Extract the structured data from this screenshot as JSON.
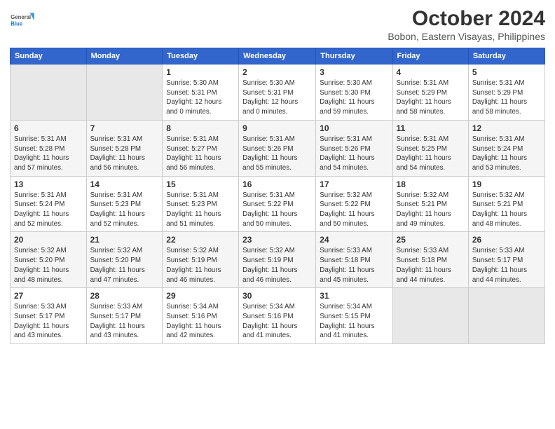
{
  "logo": {
    "line1": "General",
    "line2": "Blue"
  },
  "title": "October 2024",
  "subtitle": "Bobon, Eastern Visayas, Philippines",
  "weekdays": [
    "Sunday",
    "Monday",
    "Tuesday",
    "Wednesday",
    "Thursday",
    "Friday",
    "Saturday"
  ],
  "weeks": [
    [
      {
        "day": "",
        "info": ""
      },
      {
        "day": "",
        "info": ""
      },
      {
        "day": "1",
        "info": "Sunrise: 5:30 AM\nSunset: 5:31 PM\nDaylight: 12 hours\nand 0 minutes."
      },
      {
        "day": "2",
        "info": "Sunrise: 5:30 AM\nSunset: 5:31 PM\nDaylight: 12 hours\nand 0 minutes."
      },
      {
        "day": "3",
        "info": "Sunrise: 5:30 AM\nSunset: 5:30 PM\nDaylight: 11 hours\nand 59 minutes."
      },
      {
        "day": "4",
        "info": "Sunrise: 5:31 AM\nSunset: 5:29 PM\nDaylight: 11 hours\nand 58 minutes."
      },
      {
        "day": "5",
        "info": "Sunrise: 5:31 AM\nSunset: 5:29 PM\nDaylight: 11 hours\nand 58 minutes."
      }
    ],
    [
      {
        "day": "6",
        "info": "Sunrise: 5:31 AM\nSunset: 5:28 PM\nDaylight: 11 hours\nand 57 minutes."
      },
      {
        "day": "7",
        "info": "Sunrise: 5:31 AM\nSunset: 5:28 PM\nDaylight: 11 hours\nand 56 minutes."
      },
      {
        "day": "8",
        "info": "Sunrise: 5:31 AM\nSunset: 5:27 PM\nDaylight: 11 hours\nand 56 minutes."
      },
      {
        "day": "9",
        "info": "Sunrise: 5:31 AM\nSunset: 5:26 PM\nDaylight: 11 hours\nand 55 minutes."
      },
      {
        "day": "10",
        "info": "Sunrise: 5:31 AM\nSunset: 5:26 PM\nDaylight: 11 hours\nand 54 minutes."
      },
      {
        "day": "11",
        "info": "Sunrise: 5:31 AM\nSunset: 5:25 PM\nDaylight: 11 hours\nand 54 minutes."
      },
      {
        "day": "12",
        "info": "Sunrise: 5:31 AM\nSunset: 5:24 PM\nDaylight: 11 hours\nand 53 minutes."
      }
    ],
    [
      {
        "day": "13",
        "info": "Sunrise: 5:31 AM\nSunset: 5:24 PM\nDaylight: 11 hours\nand 52 minutes."
      },
      {
        "day": "14",
        "info": "Sunrise: 5:31 AM\nSunset: 5:23 PM\nDaylight: 11 hours\nand 52 minutes."
      },
      {
        "day": "15",
        "info": "Sunrise: 5:31 AM\nSunset: 5:23 PM\nDaylight: 11 hours\nand 51 minutes."
      },
      {
        "day": "16",
        "info": "Sunrise: 5:31 AM\nSunset: 5:22 PM\nDaylight: 11 hours\nand 50 minutes."
      },
      {
        "day": "17",
        "info": "Sunrise: 5:32 AM\nSunset: 5:22 PM\nDaylight: 11 hours\nand 50 minutes."
      },
      {
        "day": "18",
        "info": "Sunrise: 5:32 AM\nSunset: 5:21 PM\nDaylight: 11 hours\nand 49 minutes."
      },
      {
        "day": "19",
        "info": "Sunrise: 5:32 AM\nSunset: 5:21 PM\nDaylight: 11 hours\nand 48 minutes."
      }
    ],
    [
      {
        "day": "20",
        "info": "Sunrise: 5:32 AM\nSunset: 5:20 PM\nDaylight: 11 hours\nand 48 minutes."
      },
      {
        "day": "21",
        "info": "Sunrise: 5:32 AM\nSunset: 5:20 PM\nDaylight: 11 hours\nand 47 minutes."
      },
      {
        "day": "22",
        "info": "Sunrise: 5:32 AM\nSunset: 5:19 PM\nDaylight: 11 hours\nand 46 minutes."
      },
      {
        "day": "23",
        "info": "Sunrise: 5:32 AM\nSunset: 5:19 PM\nDaylight: 11 hours\nand 46 minutes."
      },
      {
        "day": "24",
        "info": "Sunrise: 5:33 AM\nSunset: 5:18 PM\nDaylight: 11 hours\nand 45 minutes."
      },
      {
        "day": "25",
        "info": "Sunrise: 5:33 AM\nSunset: 5:18 PM\nDaylight: 11 hours\nand 44 minutes."
      },
      {
        "day": "26",
        "info": "Sunrise: 5:33 AM\nSunset: 5:17 PM\nDaylight: 11 hours\nand 44 minutes."
      }
    ],
    [
      {
        "day": "27",
        "info": "Sunrise: 5:33 AM\nSunset: 5:17 PM\nDaylight: 11 hours\nand 43 minutes."
      },
      {
        "day": "28",
        "info": "Sunrise: 5:33 AM\nSunset: 5:17 PM\nDaylight: 11 hours\nand 43 minutes."
      },
      {
        "day": "29",
        "info": "Sunrise: 5:34 AM\nSunset: 5:16 PM\nDaylight: 11 hours\nand 42 minutes."
      },
      {
        "day": "30",
        "info": "Sunrise: 5:34 AM\nSunset: 5:16 PM\nDaylight: 11 hours\nand 41 minutes."
      },
      {
        "day": "31",
        "info": "Sunrise: 5:34 AM\nSunset: 5:15 PM\nDaylight: 11 hours\nand 41 minutes."
      },
      {
        "day": "",
        "info": ""
      },
      {
        "day": "",
        "info": ""
      }
    ]
  ]
}
